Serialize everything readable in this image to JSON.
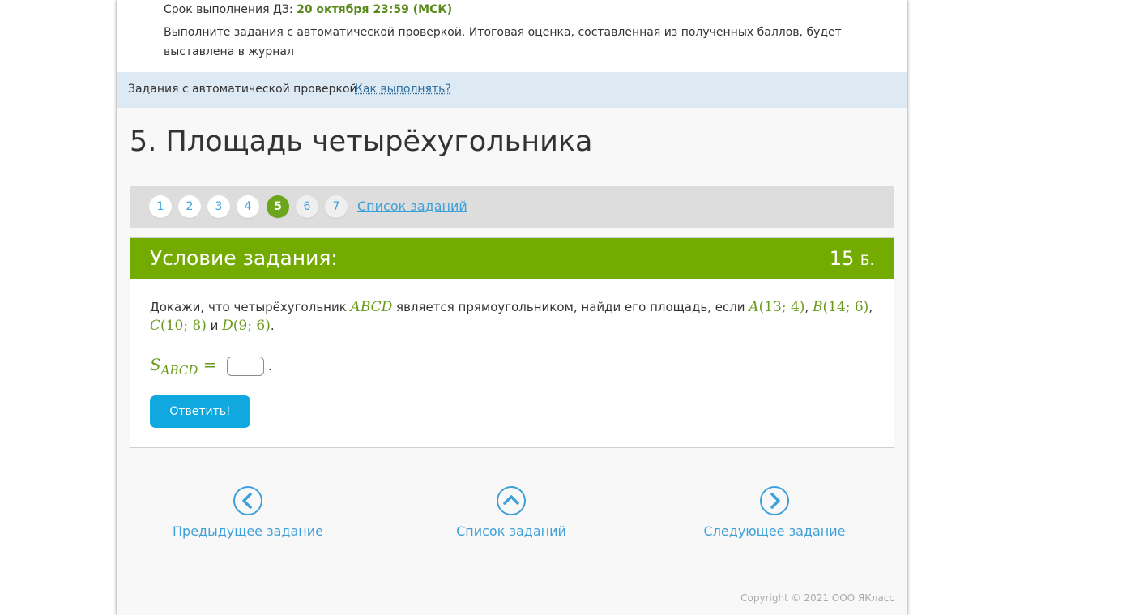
{
  "info": {
    "deadline_label": "Срок выполнения ДЗ: ",
    "deadline_value": "20 октября 23:59 (МСК)",
    "instruction": "Выполните задания с автоматической проверкой. Итоговая оценка, составленная из полученных баллов, будет выставлена в журнал"
  },
  "auto_bar": {
    "label": "Задания с автоматической проверкой",
    "howto": "Как выполнять?"
  },
  "task_title": "5. Площадь четырёхугольника",
  "pager": {
    "pages": [
      "1",
      "2",
      "3",
      "4",
      "5",
      "6",
      "7"
    ],
    "active": "5",
    "list_link": "Список заданий"
  },
  "condition": {
    "header": "Условие задания:",
    "points": "15",
    "points_unit": "Б.",
    "text_1": "Докажи, что четырёхугольник ",
    "quad": "ABCD",
    "text_2": " является прямоугольником, найди его площадь, если ",
    "pA": "A",
    "cA": "(13; 4)",
    "pB": "B",
    "cB": "(14; 6)",
    "pC": "C",
    "cC": "(10; 8)",
    "text_and": " и ",
    "pD": "D",
    "cD": "(9; 6)",
    "formula_s": "S",
    "formula_sub": "ABCD",
    "formula_eq": " = ",
    "submit": "Ответить!"
  },
  "nav": {
    "prev": "Предыдущее задание",
    "list": "Список заданий",
    "next": "Следующее задание"
  },
  "copyright": "Copyright © 2021 ООО ЯКласс",
  "colors": {
    "accent_green": "#74ab00",
    "link_blue": "#3ea0d8",
    "button_blue": "#0fa8df"
  }
}
